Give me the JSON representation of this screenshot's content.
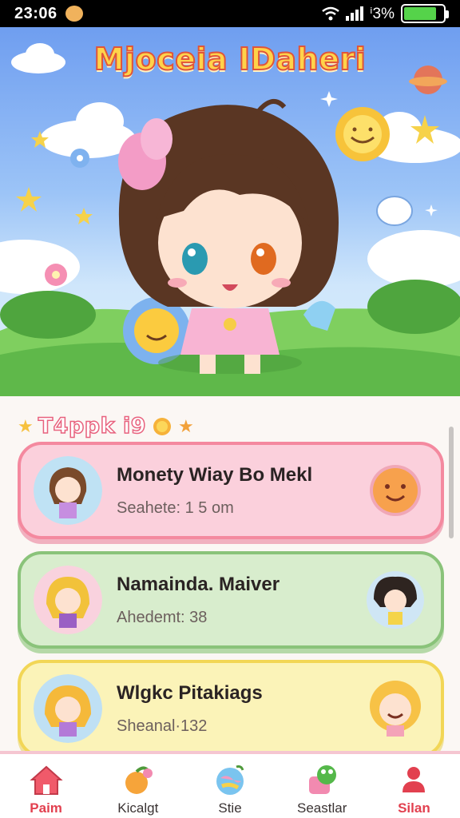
{
  "status_bar": {
    "time": "23:06",
    "battery_percent": "ⁱ3%",
    "battery_level": 0.83,
    "icons": [
      "bear-icon",
      "wifi-icon",
      "signal-icon",
      "battery-icon"
    ]
  },
  "hero": {
    "title": "Mjoceia IDaheri"
  },
  "section": {
    "label": "T4ppk i9"
  },
  "cards": [
    {
      "title": "Monety Wiay Bo Mekl",
      "subtitle": "Seahete: 1 5 om",
      "theme": "pink"
    },
    {
      "title": "Namainda. Maiver",
      "subtitle": "Ahedemt: 38",
      "theme": "green"
    },
    {
      "title": "Wlgkc Pitakiags",
      "subtitle": "Sheanal·132",
      "theme": "yellow"
    }
  ],
  "nav": {
    "items": [
      {
        "label": "Paim",
        "icon": "home-icon"
      },
      {
        "label": "Kicalgt",
        "icon": "fruit-icon"
      },
      {
        "label": "Stie",
        "icon": "globe-icon"
      },
      {
        "label": "Seastlar",
        "icon": "frog-icon"
      },
      {
        "label": "Silan",
        "icon": "profile-icon"
      }
    ]
  },
  "colors": {
    "accent": "#e2404f",
    "pink_card": "#fbd0dc",
    "green_card": "#d8edcd",
    "yellow_card": "#fbf3b8"
  }
}
